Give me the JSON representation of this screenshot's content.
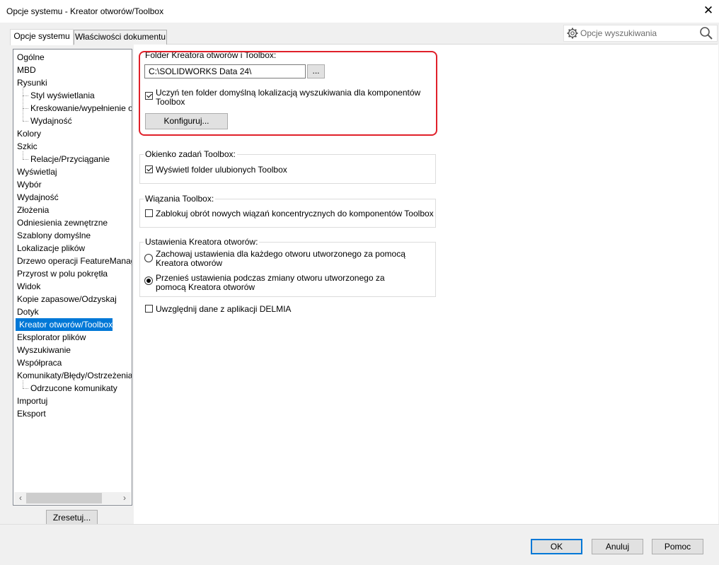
{
  "window": {
    "title": "Opcje systemu - Kreator otworów/Toolbox"
  },
  "tabs": [
    {
      "label": "Opcje systemu",
      "active": true
    },
    {
      "label": "Właściwości dokumentu",
      "active": false
    }
  ],
  "search": {
    "placeholder": "Opcje wyszukiwania"
  },
  "tree": {
    "items": [
      {
        "label": "Ogólne",
        "level": 0
      },
      {
        "label": "MBD",
        "level": 0
      },
      {
        "label": "Rysunki",
        "level": 0
      },
      {
        "label": "Styl wyświetlania",
        "level": 1
      },
      {
        "label": "Kreskowanie/wypełnienie o",
        "level": 1
      },
      {
        "label": "Wydajność",
        "level": 1
      },
      {
        "label": "Kolory",
        "level": 0
      },
      {
        "label": "Szkic",
        "level": 0
      },
      {
        "label": "Relacje/Przyciąganie",
        "level": 1
      },
      {
        "label": "Wyświetlaj",
        "level": 0
      },
      {
        "label": "Wybór",
        "level": 0
      },
      {
        "label": "Wydajność",
        "level": 0
      },
      {
        "label": "Złożenia",
        "level": 0
      },
      {
        "label": "Odniesienia zewnętrzne",
        "level": 0
      },
      {
        "label": "Szablony domyślne",
        "level": 0
      },
      {
        "label": "Lokalizacje plików",
        "level": 0
      },
      {
        "label": "Drzewo operacji FeatureManag",
        "level": 0
      },
      {
        "label": "Przyrost w polu pokrętła",
        "level": 0
      },
      {
        "label": "Widok",
        "level": 0
      },
      {
        "label": "Kopie zapasowe/Odzyskaj",
        "level": 0
      },
      {
        "label": "Dotyk",
        "level": 0
      },
      {
        "label": "Kreator otworów/Toolbox",
        "level": 0,
        "selected": true
      },
      {
        "label": "Eksplorator plików",
        "level": 0
      },
      {
        "label": "Wyszukiwanie",
        "level": 0
      },
      {
        "label": "Współpraca",
        "level": 0
      },
      {
        "label": "Komunikaty/Błędy/Ostrzeżenia",
        "level": 0
      },
      {
        "label": "Odrzucone komunikaty",
        "level": 1
      },
      {
        "label": "Importuj",
        "level": 0
      },
      {
        "label": "Eksport",
        "level": 0
      }
    ],
    "reset_label": "Zresetuj..."
  },
  "folder_group": {
    "title": "Folder Kreatora otworów i Toolbox:",
    "path_value": "C:\\SOLIDWORKS Data 24\\",
    "browse_label": "...",
    "default_location_label": "Uczyń ten folder domyślną lokalizacją wyszukiwania dla komponentów Toolbox",
    "default_location_checked": true,
    "configure_label": "Konfiguruj..."
  },
  "taskpane_group": {
    "title": "Okienko zadań Toolbox:",
    "show_favorites_label": "Wyświetl folder ulubionych Toolbox",
    "show_favorites_checked": true
  },
  "mates_group": {
    "title": "Wiązania Toolbox:",
    "lock_rotation_label": "Zablokuj obrót nowych wiązań koncentrycznych do komponentów Toolbox",
    "lock_rotation_checked": false
  },
  "hole_wizard_group": {
    "title": "Ustawienia Kreatora otworów:",
    "option_keep_label": "Zachowaj ustawienia dla każdego otworu utworzonego za pomocą Kreatora otworów",
    "option_carry_label": "Przenieś ustawienia podczas zmiany otworu utworzonego za pomocą Kreatora otworów",
    "selected": "carry"
  },
  "delmia": {
    "label": "Uwzględnij dane z aplikacji DELMIA",
    "checked": false
  },
  "footer": {
    "ok_label": "OK",
    "cancel_label": "Anuluj",
    "help_label": "Pomoc"
  },
  "colors": {
    "selection": "#0078d7",
    "highlight_box": "#e0202a"
  }
}
